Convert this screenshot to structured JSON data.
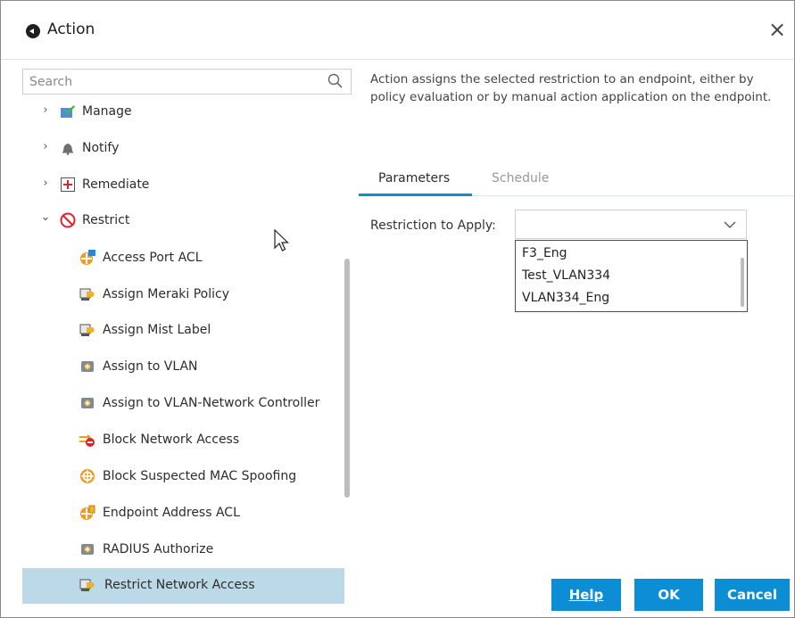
{
  "window": {
    "title": "Action",
    "close_label": "×"
  },
  "search": {
    "placeholder": "Search"
  },
  "tree": {
    "groups": [
      {
        "label": "Manage",
        "expanded": false,
        "chevron": "›",
        "icon": "manage-icon"
      },
      {
        "label": "Notify",
        "expanded": false,
        "chevron": "›",
        "icon": "bell-icon"
      },
      {
        "label": "Remediate",
        "expanded": false,
        "chevron": "›",
        "icon": "remediate-plus-icon"
      },
      {
        "label": "Restrict",
        "expanded": true,
        "chevron": "⌄",
        "icon": "restrict-icon"
      }
    ],
    "restrict_items": [
      {
        "label": "Access Port ACL",
        "icon": "access-port-acl-icon",
        "selected": false
      },
      {
        "label": "Assign Meraki Policy",
        "icon": "policy-tag-icon",
        "selected": false
      },
      {
        "label": "Assign Mist Label",
        "icon": "policy-tag-icon",
        "selected": false
      },
      {
        "label": "Assign to VLAN",
        "icon": "vlan-icon",
        "selected": false
      },
      {
        "label": "Assign to VLAN-Network Controller",
        "icon": "vlan-icon",
        "selected": false
      },
      {
        "label": "Block Network Access",
        "icon": "block-network-icon",
        "selected": false
      },
      {
        "label": "Block Suspected MAC Spoofing",
        "icon": "mac-spoof-icon",
        "selected": false
      },
      {
        "label": "Endpoint Address ACL",
        "icon": "endpoint-acl-icon",
        "selected": false
      },
      {
        "label": "RADIUS Authorize",
        "icon": "vlan-icon",
        "selected": false
      },
      {
        "label": "Restrict Network Access",
        "icon": "policy-tag-icon",
        "selected": true
      }
    ]
  },
  "details": {
    "description": "Action assigns the selected restriction to an endpoint, either by policy evaluation or by manual action application on the endpoint.",
    "tabs": [
      {
        "label": "Parameters",
        "active": true
      },
      {
        "label": "Schedule",
        "active": false
      }
    ],
    "restriction_label": "Restriction to Apply:",
    "restriction_value": "",
    "options": [
      "F3_Eng",
      "Test_VLAN334",
      "VLAN334_Eng"
    ]
  },
  "buttons": {
    "help": "Help",
    "ok": "OK",
    "cancel": "Cancel"
  },
  "colors": {
    "accent": "#0d8dd3",
    "selected_row": "#bcd9e8",
    "tab_underline": "#0e8ed1"
  }
}
